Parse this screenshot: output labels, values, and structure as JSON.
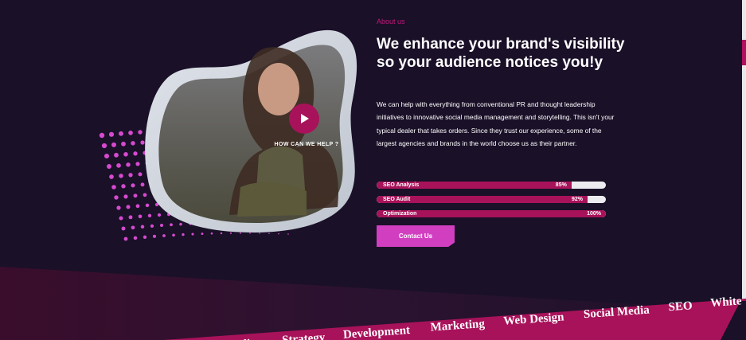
{
  "about": {
    "label": "About us",
    "headline": "We enhance your brand's visibility so your audience notices you!y",
    "description": "We can help with everything from conventional PR and thought leadership initiatives to innovative social media management and storytelling. This isn't your typical dealer that takes orders. Since they trust our experience, some of the largest agencies and brands in the world choose us as their partner."
  },
  "video": {
    "caption": "HOW CAN WE HELP ?",
    "play_icon": "play-icon"
  },
  "skills": [
    {
      "label": "SEO Analysis",
      "percent_text": "85%",
      "value": 85
    },
    {
      "label": "SEO Audit",
      "percent_text": "92%",
      "value": 92
    },
    {
      "label": "Optimization",
      "percent_text": "100%",
      "value": 100
    }
  ],
  "cta": {
    "label": "Contact Us"
  },
  "services": [
    "Branding",
    "Strategy",
    "Development",
    "Marketing",
    "Web Design",
    "Social Media",
    "SEO",
    "White"
  ],
  "colors": {
    "background": "#1a1028",
    "accent": "#a8125a",
    "label_pink": "#c2187a",
    "button": "#d13fc0",
    "dots": "#d64ad0"
  }
}
